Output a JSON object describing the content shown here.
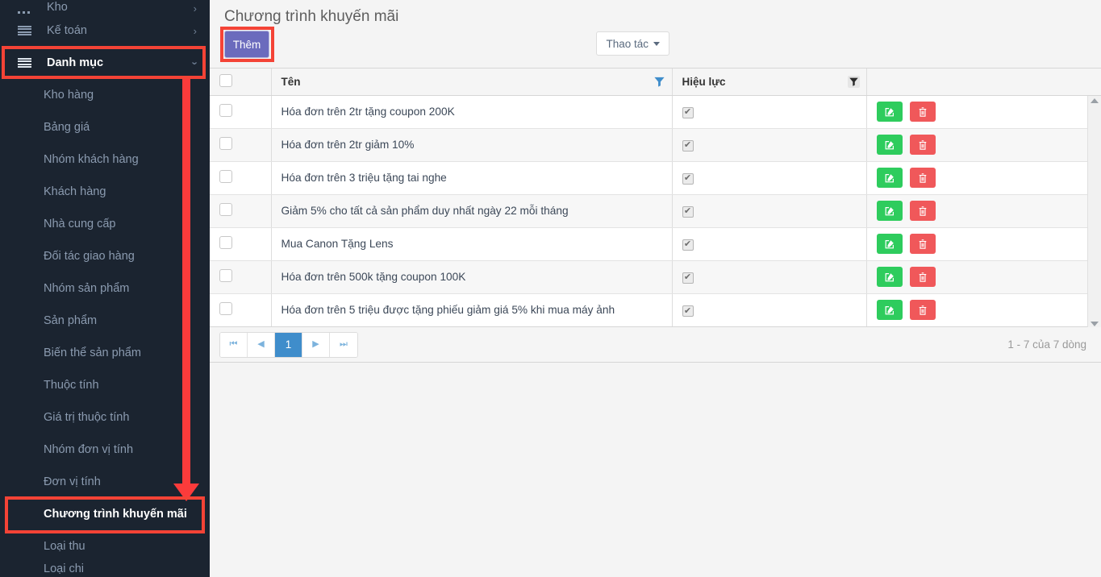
{
  "sidebar": {
    "parents": [
      {
        "label": "Kho",
        "icon": "dots-icon",
        "chevron": "chevron-right",
        "partial": true,
        "active": false
      },
      {
        "label": "Kế toán",
        "icon": "list-icon",
        "chevron": "chevron-right",
        "partial": false,
        "active": false
      },
      {
        "label": "Danh mục",
        "icon": "list-icon",
        "chevron": "chevron-down",
        "partial": false,
        "active": true
      }
    ],
    "children": [
      {
        "label": "Kho hàng",
        "active": false
      },
      {
        "label": "Bảng giá",
        "active": false
      },
      {
        "label": "Nhóm khách hàng",
        "active": false
      },
      {
        "label": "Khách hàng",
        "active": false
      },
      {
        "label": "Nhà cung cấp",
        "active": false
      },
      {
        "label": "Đối tác giao hàng",
        "active": false
      },
      {
        "label": "Nhóm sản phẩm",
        "active": false
      },
      {
        "label": "Sản phẩm",
        "active": false
      },
      {
        "label": "Biến thể sản phẩm",
        "active": false
      },
      {
        "label": "Thuộc tính",
        "active": false
      },
      {
        "label": "Giá trị thuộc tính",
        "active": false
      },
      {
        "label": "Nhóm đơn vị tính",
        "active": false
      },
      {
        "label": "Đơn vị tính",
        "active": false
      },
      {
        "label": "Chương trình khuyến mãi",
        "active": true
      },
      {
        "label": "Loại thu",
        "active": false
      },
      {
        "label": "Loại chi",
        "active": false
      }
    ]
  },
  "header": {
    "title": "Chương trình khuyến mãi"
  },
  "toolbar": {
    "add_label": "Thêm",
    "action_label": "Thao tác",
    "caret_icon": "caret-down-icon"
  },
  "grid": {
    "columns": [
      {
        "key": "checkbox",
        "label": "",
        "filter": false
      },
      {
        "key": "name",
        "label": "Tên",
        "filter": true
      },
      {
        "key": "effective",
        "label": "Hiệu lực",
        "filter": true
      },
      {
        "key": "actions",
        "label": "",
        "filter": false
      }
    ],
    "rows": [
      {
        "name": "Hóa đơn trên 2tr tặng coupon 200K",
        "effective": true
      },
      {
        "name": "Hóa đơn trên 2tr giảm 10%",
        "effective": true
      },
      {
        "name": "Hóa đơn trên 3 triệu tặng tai nghe",
        "effective": true
      },
      {
        "name": "Giảm 5% cho tất cả sản phẩm duy nhất ngày 22 mỗi tháng",
        "effective": true
      },
      {
        "name": "Mua Canon Tặng Lens",
        "effective": true
      },
      {
        "name": "Hóa đơn trên 500k tặng coupon 100K",
        "effective": true
      },
      {
        "name": "Hóa đơn trên 5 triệu được tặng phiếu giảm giá 5% khi mua máy ảnh",
        "effective": true
      }
    ],
    "row_actions": {
      "edit_icon": "edit-pencil-square-icon",
      "delete_icon": "trash-icon"
    },
    "check_mark": "✔",
    "filter_icon": "funnel-filter-icon",
    "scrollbar": {
      "up_icon": "scroll-up-arrow-icon",
      "down_icon": "scroll-down-arrow-icon"
    }
  },
  "pager": {
    "first_icon": "page-first-icon",
    "prev_icon": "page-prev-icon",
    "next_icon": "page-next-icon",
    "last_icon": "page-last-icon",
    "first_glyph": "⏮",
    "prev_glyph": "◀",
    "next_glyph": "▶",
    "last_glyph": "⏭",
    "current_page": "1",
    "info": "1 - 7 của 7 dòng"
  },
  "colors": {
    "sidebar_bg": "#1b2430",
    "accent_purple": "#6b6bbd",
    "annotation_red": "#f44336",
    "edit_green": "#2ecc5d",
    "delete_red": "#f0585a",
    "pager_blue": "#3f8dcb"
  }
}
